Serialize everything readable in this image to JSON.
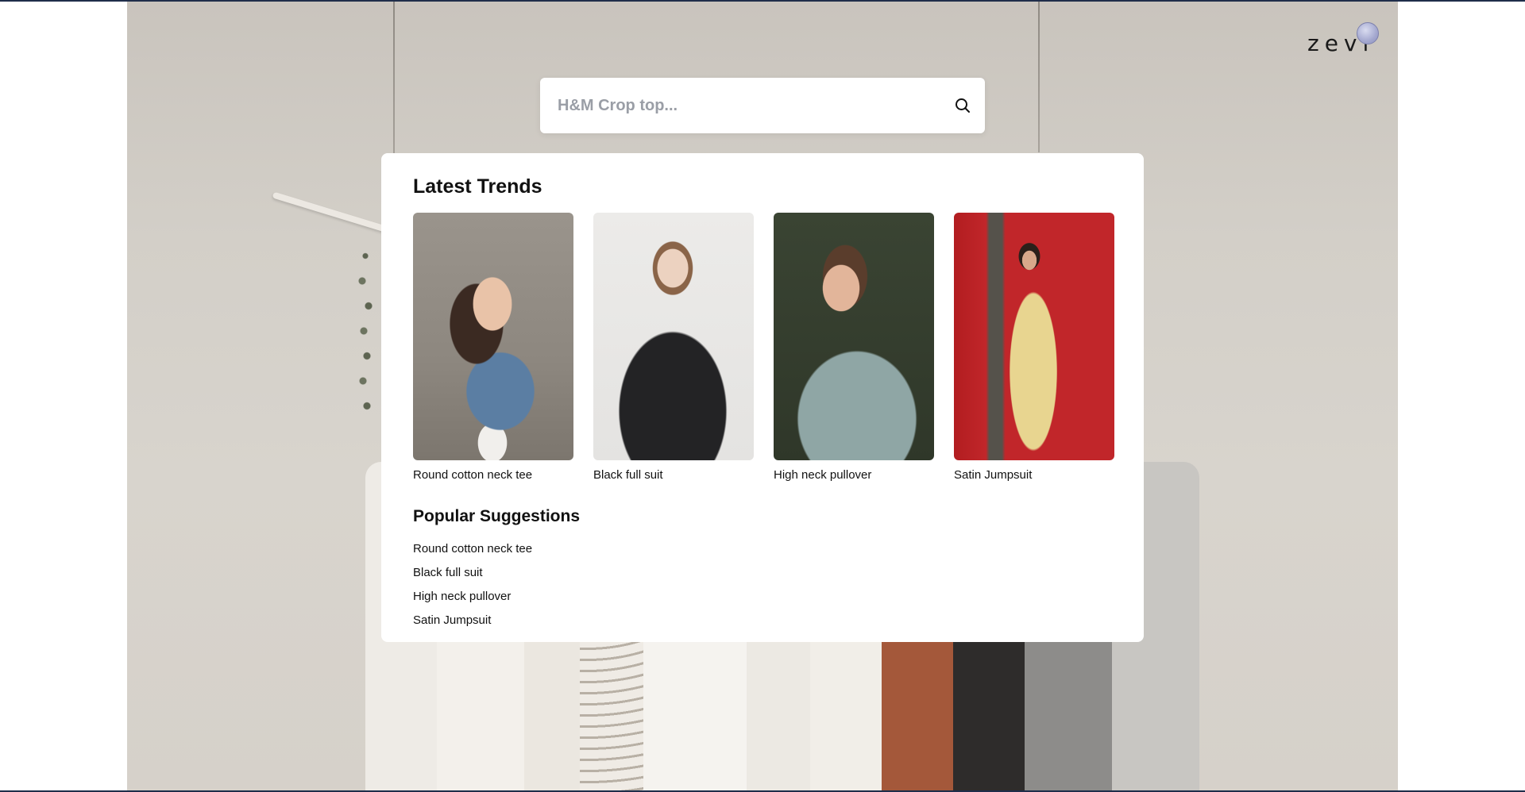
{
  "brand": {
    "logo_text": "zevi"
  },
  "search": {
    "placeholder": "H&M Crop top...",
    "value": ""
  },
  "trends": {
    "title": "Latest Trends",
    "items": [
      {
        "label": "Round cotton neck tee"
      },
      {
        "label": "Black full suit"
      },
      {
        "label": "High neck pullover"
      },
      {
        "label": "Satin Jumpsuit"
      }
    ]
  },
  "popular": {
    "title": "Popular Suggestions",
    "items": [
      {
        "label": "Round cotton neck tee"
      },
      {
        "label": "Black full suit"
      },
      {
        "label": "High neck pullover"
      },
      {
        "label": "Satin Jumpsuit"
      }
    ]
  },
  "colors": {
    "accent_border": "#1f2d4a",
    "panel_bg": "#ffffff",
    "text": "#111111",
    "placeholder": "#9a9ea6"
  },
  "icons": {
    "search": "search-icon",
    "logo_dot": "logo-dot"
  }
}
